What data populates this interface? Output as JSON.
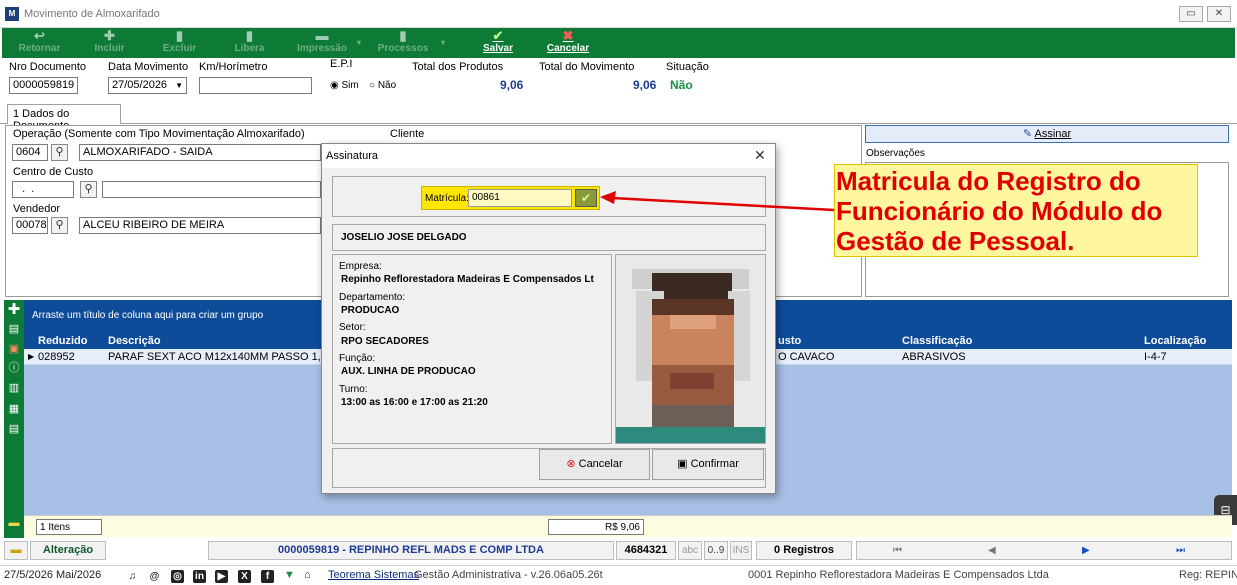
{
  "window": {
    "title": "Movimento de Almoxarifado"
  },
  "toolbar": {
    "retornar": "Retornar",
    "incluir": "Incluir",
    "excluir": "Excluir",
    "libera": "Libera",
    "impressao": "Impressão",
    "processos": "Processos",
    "salvar": "Salvar",
    "cancelar": "Cancelar"
  },
  "header": {
    "nro_documento_label": "Nro Documento",
    "nro_documento": "0000059819",
    "data_movimento_label": "Data Movimento",
    "data_movimento": "27/05/2026",
    "km_label": "Km/Horímetro",
    "km_value": "",
    "epi_label": "E.P.I",
    "epi_sim": "Sim",
    "epi_nao": "Não",
    "epi_selected": "Sim",
    "total_produtos_label": "Total dos Produtos",
    "total_produtos": "9,06",
    "total_movimento_label": "Total do Movimento",
    "total_movimento": "9,06",
    "situacao_label": "Situação",
    "situacao": "Não"
  },
  "tabs": [
    {
      "label": "1 Dados do Documento"
    }
  ],
  "form": {
    "operacao_label": "Operação (Somente com Tipo Movimentação Almoxarifado)",
    "operacao_code": "0604",
    "operacao_desc": "ALMOXARIFADO - SAIDA",
    "cliente_label": "Cliente",
    "centro_custo_label": "Centro de Custo",
    "centro_custo_code": "  .  .",
    "vendedor_label": "Vendedor",
    "vendedor_code": "00078",
    "vendedor_desc": "ALCEU RIBEIRO DE MEIRA",
    "assinar_label": "Assinar",
    "observacoes_label": "Observações"
  },
  "grid": {
    "group_hint": "Arraste um título de coluna aqui para criar um grupo",
    "columns": [
      "Reduzido",
      "Descrição",
      "usto",
      "Classificação",
      "Localização"
    ],
    "rows": [
      {
        "reduzido": "028952",
        "descricao": "PARAF SEXT ACO M12x140MM PASSO 1,75",
        "custo": "O CAVACO",
        "classificacao": "ABRASIVOS",
        "localizacao": "I-4-7"
      }
    ],
    "itens": "1 Itens",
    "total": "R$ 9,06"
  },
  "status": {
    "mode": "Alteração",
    "document": "0000059819 - REPINHO REFL MADS E COMP LTDA",
    "code": "4684321",
    "abc": "abc",
    "nums": "0..9",
    "ins": "INS",
    "registros": "0 Registros"
  },
  "bottom": {
    "date": "27/5/2026 Mai/2026",
    "company_link": "Teorema Sistemas",
    "version": "Gestão Administrativa - v.26.06a05.26t",
    "company": "0001 Repinho Reflorestadora Madeiras E Compensados Ltda",
    "reg": "Reg: REPINH"
  },
  "dialog": {
    "title": "Assinatura",
    "matricula_label": "Matrícula:",
    "matricula_value": "00861",
    "employee_name": "JOSELIO JOSE DELGADO",
    "empresa_label": "Empresa:",
    "empresa": "Repinho Reflorestadora Madeiras E Compensados Lt",
    "departamento_label": "Departamento:",
    "departamento": "PRODUCAO",
    "setor_label": "Setor:",
    "setor": "RPO SECADORES",
    "funcao_label": "Função:",
    "funcao": "AUX. LINHA DE PRODUCAO",
    "turno_label": "Turno:",
    "turno": "13:00 as 16:00 e 17:00 as 21:20",
    "cancelar": "Cancelar",
    "confirmar": "Confirmar"
  },
  "annotation": {
    "line1": "Matricula do Registro do",
    "line2": "Funcionário  do Módulo do",
    "line3": "Gestão de Pessoal."
  },
  "colors": {
    "toolbar": "#0d7a35",
    "grid_header": "#0e4c9a",
    "annotation_text": "#e00000",
    "annotation_bg": "#fff6a0"
  }
}
